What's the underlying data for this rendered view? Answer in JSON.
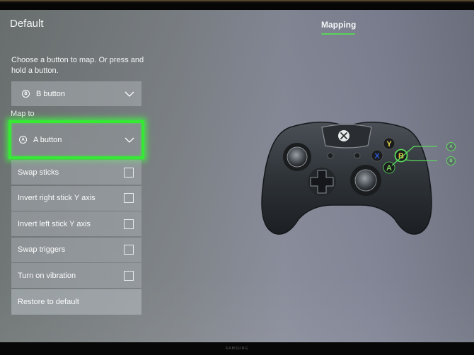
{
  "header": {
    "title": "Default",
    "tabs": [
      {
        "label": "Mapping",
        "active": true
      }
    ]
  },
  "instructions": "Choose a button to map. Or press and hold a button.",
  "source_button": {
    "glyph": "B",
    "label": "B button",
    "icon": "chevron-down-icon"
  },
  "map_to": {
    "label": "Map to",
    "target": {
      "glyph": "A",
      "label": "A button",
      "icon": "chevron-down-icon",
      "highlight_color": "#35e935"
    }
  },
  "options": [
    {
      "label": "Swap sticks",
      "checked": false
    },
    {
      "label": "Invert right stick Y axis",
      "checked": false
    },
    {
      "label": "Invert left stick Y axis",
      "checked": false
    },
    {
      "label": "Swap triggers",
      "checked": false
    },
    {
      "label": "Turn on vibration",
      "checked": false
    }
  ],
  "restore_label": "Restore to default",
  "controller": {
    "face_buttons": [
      {
        "letter": "Y",
        "color": "#e8d84a"
      },
      {
        "letter": "X",
        "color": "#2d5bd8"
      },
      {
        "letter": "B",
        "color": "#e0c23a",
        "highlighted": true
      },
      {
        "letter": "A",
        "color": "#7fd35a",
        "highlighted": true
      }
    ],
    "callouts": [
      {
        "glyph": "A"
      },
      {
        "glyph": "B"
      }
    ],
    "accent_color": "#5bd95b"
  },
  "bezel_brand": "SAMSUNG"
}
